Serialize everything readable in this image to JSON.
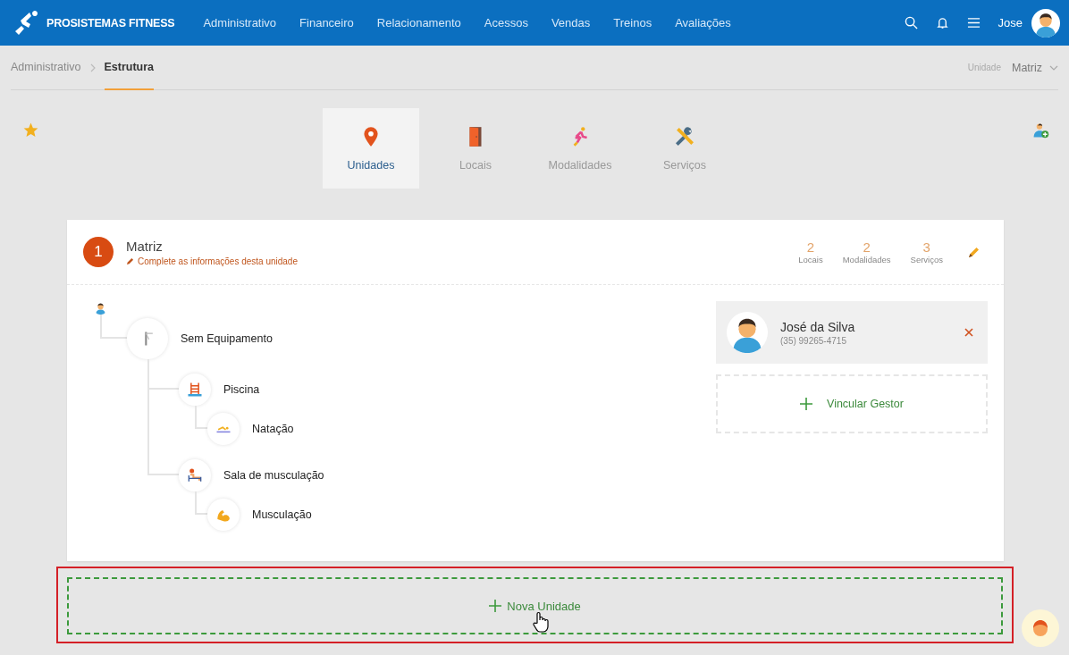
{
  "brand": "PROSISTEMAS FITNESS",
  "nav": [
    "Administrativo",
    "Financeiro",
    "Relacionamento",
    "Acessos",
    "Vendas",
    "Treinos",
    "Avaliações"
  ],
  "user": {
    "name": "Jose"
  },
  "breadcrumb": [
    {
      "label": "Administrativo",
      "current": false
    },
    {
      "label": "Estrutura",
      "current": true
    }
  ],
  "unit_selector": {
    "label": "Unidade",
    "value": "Matriz"
  },
  "tabs": [
    {
      "label": "Unidades",
      "kind": "pin",
      "selected": true
    },
    {
      "label": "Locais",
      "kind": "door",
      "selected": false
    },
    {
      "label": "Modalidades",
      "kind": "runner",
      "selected": false
    },
    {
      "label": "Serviços",
      "kind": "tools",
      "selected": false
    }
  ],
  "unit": {
    "number": "1",
    "name": "Matriz",
    "notice": "Complete as informações desta unidade",
    "stats": [
      {
        "value": "2",
        "label": "Locais"
      },
      {
        "value": "2",
        "label": "Modalidades"
      },
      {
        "value": "3",
        "label": "Serviços"
      }
    ],
    "tree": [
      {
        "label": "Sem Equipamento",
        "kind": "turnstile",
        "children": [
          {
            "label": "Piscina",
            "kind": "pool",
            "children": [
              {
                "label": "Natação",
                "kind": "swim"
              }
            ]
          },
          {
            "label": "Sala de musculação",
            "kind": "gym",
            "children": [
              {
                "label": "Musculação",
                "kind": "muscle"
              }
            ]
          }
        ]
      }
    ],
    "manager": {
      "name": "José da Silva",
      "phone": "(35) 99265-4715"
    },
    "link_manager": "Vincular Gestor"
  },
  "new_unit": "Nova Unidade"
}
